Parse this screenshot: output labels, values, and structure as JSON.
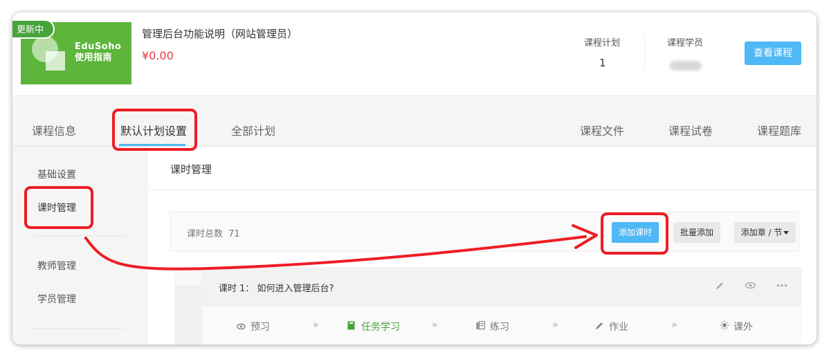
{
  "course": {
    "badge": "更新中",
    "cover_line1": "EduSoho",
    "cover_line2": "使用指南",
    "title": "管理后台功能说明（网站管理员）",
    "price": "¥0.00",
    "stats": [
      {
        "label": "课程计划",
        "value": "1"
      },
      {
        "label": "课程学员",
        "value": ""
      }
    ],
    "view_button": "查看课程"
  },
  "tabs": [
    "课程信息",
    "默认计划设置",
    "全部计划",
    "课程文件",
    "课程试卷",
    "课程题库"
  ],
  "active_tab": "默认计划设置",
  "sidebar": {
    "items": [
      "基础设置",
      "课时管理",
      "教师管理",
      "学员管理"
    ],
    "active": "课时管理"
  },
  "main": {
    "title": "课时管理",
    "count_label": "课时总数",
    "count_value": "71",
    "buttons": {
      "add_lesson": "添加课时",
      "batch_add": "批量添加",
      "add_chapter": "添加章 / 节"
    },
    "lesson": {
      "title": "课时 1： 如何进入管理后台?",
      "actions": [
        "edit-icon",
        "eye-icon",
        "more-icon"
      ],
      "tasks": [
        {
          "label": "预习",
          "icon": "eye-icon",
          "done": false
        },
        {
          "label": "任务学习",
          "icon": "book-icon",
          "done": true
        },
        {
          "label": "练习",
          "icon": "list-icon",
          "done": false
        },
        {
          "label": "作业",
          "icon": "pencil-icon",
          "done": false
        },
        {
          "label": "课外",
          "icon": "sun-icon",
          "done": false
        }
      ],
      "separator": "»"
    }
  },
  "colors": {
    "accent": "#4fb8f6",
    "cover_green": "#5db53b",
    "badge_green": "#47a43c",
    "price_red": "#e4393c",
    "annotation_red": "#ee1c24"
  }
}
